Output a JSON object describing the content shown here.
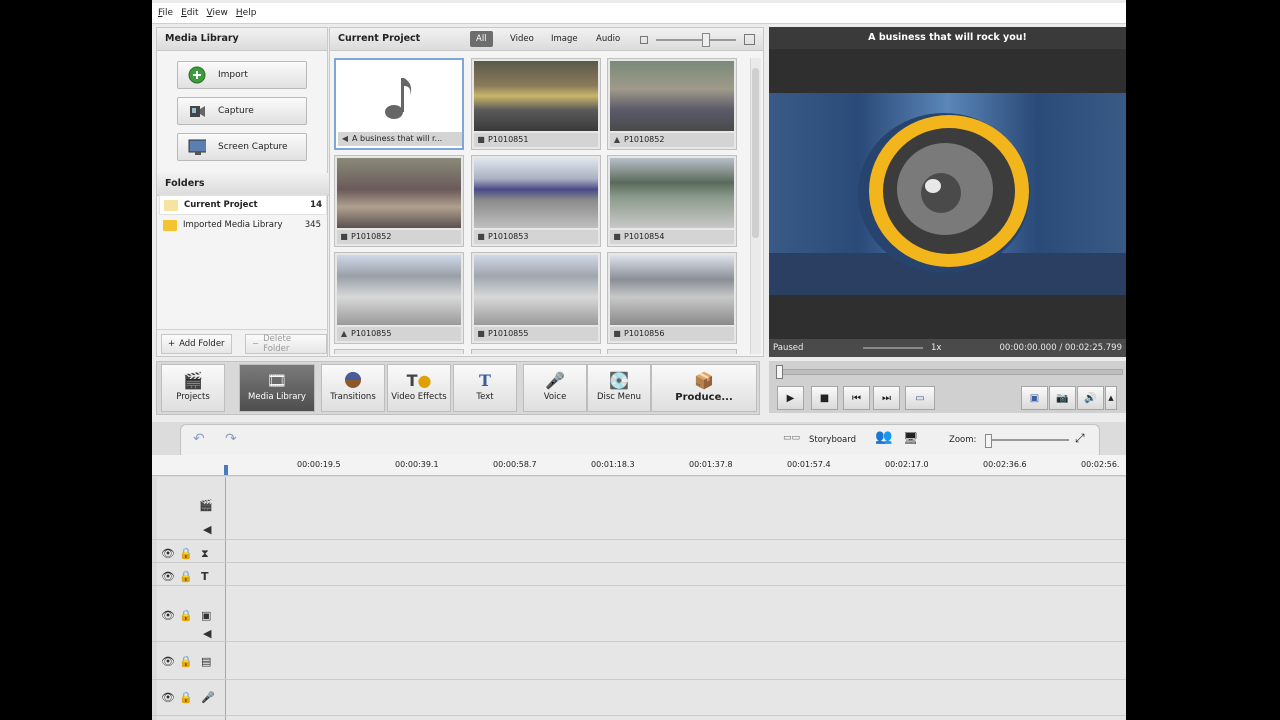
{
  "menu": [
    "File",
    "Edit",
    "View",
    "Help"
  ],
  "media_library": {
    "title": "Media Library",
    "buttons": [
      {
        "label": "Import"
      },
      {
        "label": "Capture"
      },
      {
        "label": "Screen Capture"
      }
    ],
    "folders_title": "Folders",
    "folders": [
      {
        "name": "Current Project",
        "count": "14"
      },
      {
        "name": "Imported Media Library",
        "count": "345"
      }
    ],
    "add_folder": "Add Folder",
    "delete_folder": "Delete Folder"
  },
  "current_project": {
    "title": "Current Project",
    "filters": [
      "All",
      "Video",
      "Image",
      "Audio"
    ],
    "items": [
      {
        "name": "A business that will r...",
        "kind": "audio"
      },
      {
        "name": "P1010851",
        "kind": "video"
      },
      {
        "name": "P1010852",
        "kind": "image"
      },
      {
        "name": "P1010852",
        "kind": "video"
      },
      {
        "name": "P1010853",
        "kind": "video"
      },
      {
        "name": "P1010854",
        "kind": "video"
      },
      {
        "name": "P1010855",
        "kind": "image"
      },
      {
        "name": "P1010855",
        "kind": "video"
      },
      {
        "name": "P1010856",
        "kind": "video"
      }
    ]
  },
  "preview": {
    "title": "A business that will rock you!",
    "status": "Paused",
    "speed": "1x",
    "time": "00:00:00.000 / 00:02:25.799"
  },
  "toolbar": {
    "projects": "Projects",
    "media_library": "Media Library",
    "transitions": "Transitions",
    "video_effects": "Video Effects",
    "text": "Text",
    "voice": "Voice",
    "disc_menu": "Disc Menu",
    "produce": "Produce..."
  },
  "timeline": {
    "storyboard": "Storyboard",
    "zoom_label": "Zoom:",
    "ruler": [
      "00:00:19.5",
      "00:00:39.1",
      "00:00:58.7",
      "00:01:18.3",
      "00:01:37.8",
      "00:01:57.4",
      "00:02:17.0",
      "00:02:36.6",
      "00:02:56."
    ]
  },
  "colors": {
    "accent_selected": "#7ea6d8",
    "preview_bg": "#2f2f2f",
    "speaker_yellow": "#f3b51c"
  }
}
